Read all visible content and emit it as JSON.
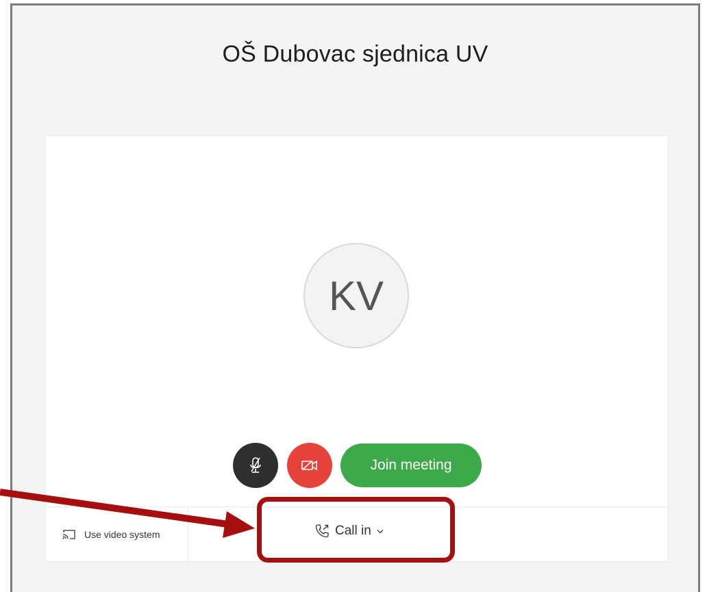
{
  "meeting": {
    "title": "OŠ Dubovac sjednica UV",
    "avatar_initials": "KV"
  },
  "controls": {
    "mute_icon": "microphone-muted-icon",
    "video_icon": "camera-off-icon",
    "join_label": "Join meeting"
  },
  "bottom": {
    "video_system_label": "Use video system",
    "video_system_icon": "cast-icon",
    "call_in_label": "Call in",
    "call_in_icon": "phone-outgoing-icon",
    "call_in_dropdown_icon": "chevron-down-icon"
  },
  "annotation": {
    "color": "#a50f0f"
  },
  "colors": {
    "join_button": "#3da94a",
    "video_button": "#e8433a",
    "mute_button": "#2f2f2f"
  }
}
